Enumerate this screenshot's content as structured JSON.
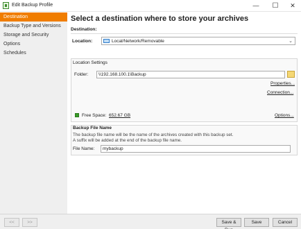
{
  "window": {
    "title": "Edit Backup Profile"
  },
  "sidebar": {
    "items": [
      {
        "label": "Destination",
        "active": true
      },
      {
        "label": "Backup Type and Versions",
        "active": false
      },
      {
        "label": "Storage and Security",
        "active": false
      },
      {
        "label": "Options",
        "active": false
      },
      {
        "label": "Schedules",
        "active": false
      }
    ]
  },
  "main": {
    "heading": "Select a destination where to store your archives",
    "destination_section": "Destination:",
    "location_label": "Location:",
    "location_value": "Local/Network/Removable",
    "location_settings_label": "Location Settings",
    "folder_label": "Folder:",
    "folder_value": "\\\\192.168.100.1\\Backup",
    "properties_link": "Properties...",
    "connection_link": "Connection...",
    "free_space_label": "Free Space:",
    "free_space_value": "652.67 GB",
    "options_link": "Options...",
    "backup_file_name_section": "Backup File Name",
    "hint_line1": "The backup file name will be the name of the archives created with this backup set.",
    "hint_line2": "A suffix will be added at the end of the backup file name.",
    "file_name_label": "File Name:",
    "file_name_value": "mybackup"
  },
  "footer": {
    "prev_label": "<<",
    "next_label": ">>",
    "save_run_label": "Save & Run",
    "save_label": "Save",
    "cancel_label": "Cancel"
  },
  "colors": {
    "accent": "#f07d00",
    "free_space": "#3a9a2a"
  }
}
